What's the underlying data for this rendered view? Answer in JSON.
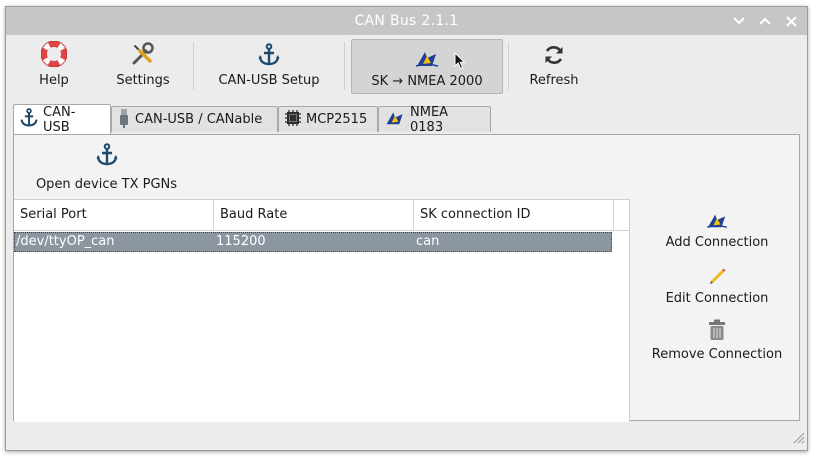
{
  "window": {
    "title": "CAN Bus 2.1.1"
  },
  "toolbar": {
    "help": "Help",
    "settings": "Settings",
    "can_usb_setup": "CAN-USB Setup",
    "sk_nmea2000": "SK → NMEA 2000",
    "refresh": "Refresh"
  },
  "tabs": [
    "CAN-USB",
    "CAN-USB / CANable",
    "MCP2515",
    "NMEA 0183"
  ],
  "panel": {
    "open_device_tx": "Open device TX PGNs",
    "columns": [
      "Serial Port",
      "Baud Rate",
      "SK connection ID"
    ],
    "rows": [
      {
        "serial_port": "/dev/ttyOP_can",
        "baud_rate": "115200",
        "sk_id": "can"
      }
    ],
    "side": {
      "add": "Add Connection",
      "edit": "Edit Connection",
      "remove": "Remove Connection"
    }
  },
  "icons": {
    "help": "lifebuoy-icon",
    "settings": "wrench-screwdriver-icon",
    "anchor": "anchor-icon",
    "signalk": "signalk-icon",
    "refresh": "refresh-icon",
    "usb": "usb-plug-icon",
    "chip": "chip-icon",
    "edit": "pencil-icon",
    "remove": "trash-icon"
  },
  "colors": {
    "titlebar": "#c6c6c6",
    "selection": "#8c96a0",
    "help_red": "#e04545",
    "signalk_blue": "#1f3f9a",
    "signalk_yellow": "#f0c400",
    "anchor": "#1e4a6e"
  }
}
